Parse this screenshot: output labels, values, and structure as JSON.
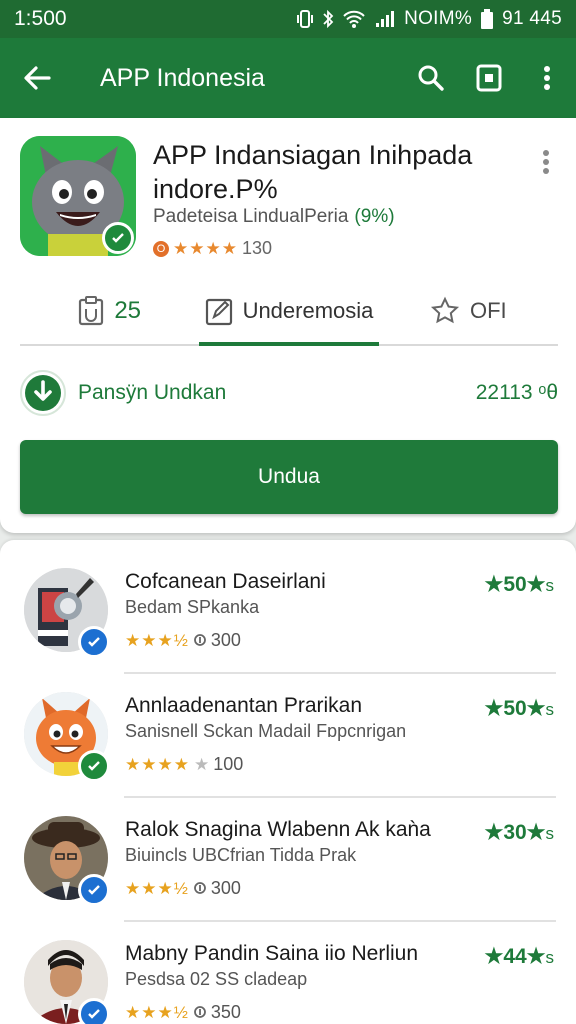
{
  "status_bar": {
    "time": "1:500",
    "carrier": "NOIM%",
    "battery": "91 445"
  },
  "app_bar": {
    "title": "APP Indonesia",
    "icons": [
      "back-arrow-icon",
      "search-icon",
      "screen-icon",
      "more-vert-icon"
    ]
  },
  "app": {
    "title_line1": "APP Indansiagan Inihpada",
    "title_line2": "indore.P%",
    "developer": "Padeteisa LindualPeria",
    "developer_pct": "(9%)",
    "rating_badge": "O",
    "rating_stars": "★★★★",
    "rating_count": "130"
  },
  "tabs": [
    {
      "icon": "clipboard-icon",
      "label": "25"
    },
    {
      "icon": "edit-icon",
      "label": "Underemosia"
    },
    {
      "icon": "star-outline-icon",
      "label": "OFI"
    }
  ],
  "download": {
    "label": "Pansÿn Undkan",
    "size": "22113 ᵒθ"
  },
  "install_button": "Undua",
  "list": [
    {
      "title": "Cofcanean Daseirlani",
      "subtitle": "Bedam SPkanka",
      "stars": "★★★½",
      "count": "300",
      "score": "50",
      "verified": "blue"
    },
    {
      "title": "Annlaadenantan Prarikan",
      "subtitle": "Sanisnell Sckan Madail Fɒpcnrigan",
      "stars": "★★★★",
      "count": "100",
      "score": "50",
      "verified": "green"
    },
    {
      "title": "Ralok Snagina Wlabenn Ak kaǹa",
      "subtitle": "Biuincls UBCfrian Tidda Prak",
      "stars": "★★★½",
      "count": "300",
      "score": "30",
      "verified": "blue"
    },
    {
      "title": "Mabny Pandin Saina iio Nerliun",
      "subtitle": "Pesdsa 02 SS cladeap",
      "stars": "★★★½",
      "count": "350",
      "score": "44",
      "verified": "blue"
    }
  ],
  "colors": {
    "primary": "#1e7a3a",
    "status": "#1f6b32",
    "star": "#e7a21f",
    "verified_blue": "#1c6fd1"
  }
}
